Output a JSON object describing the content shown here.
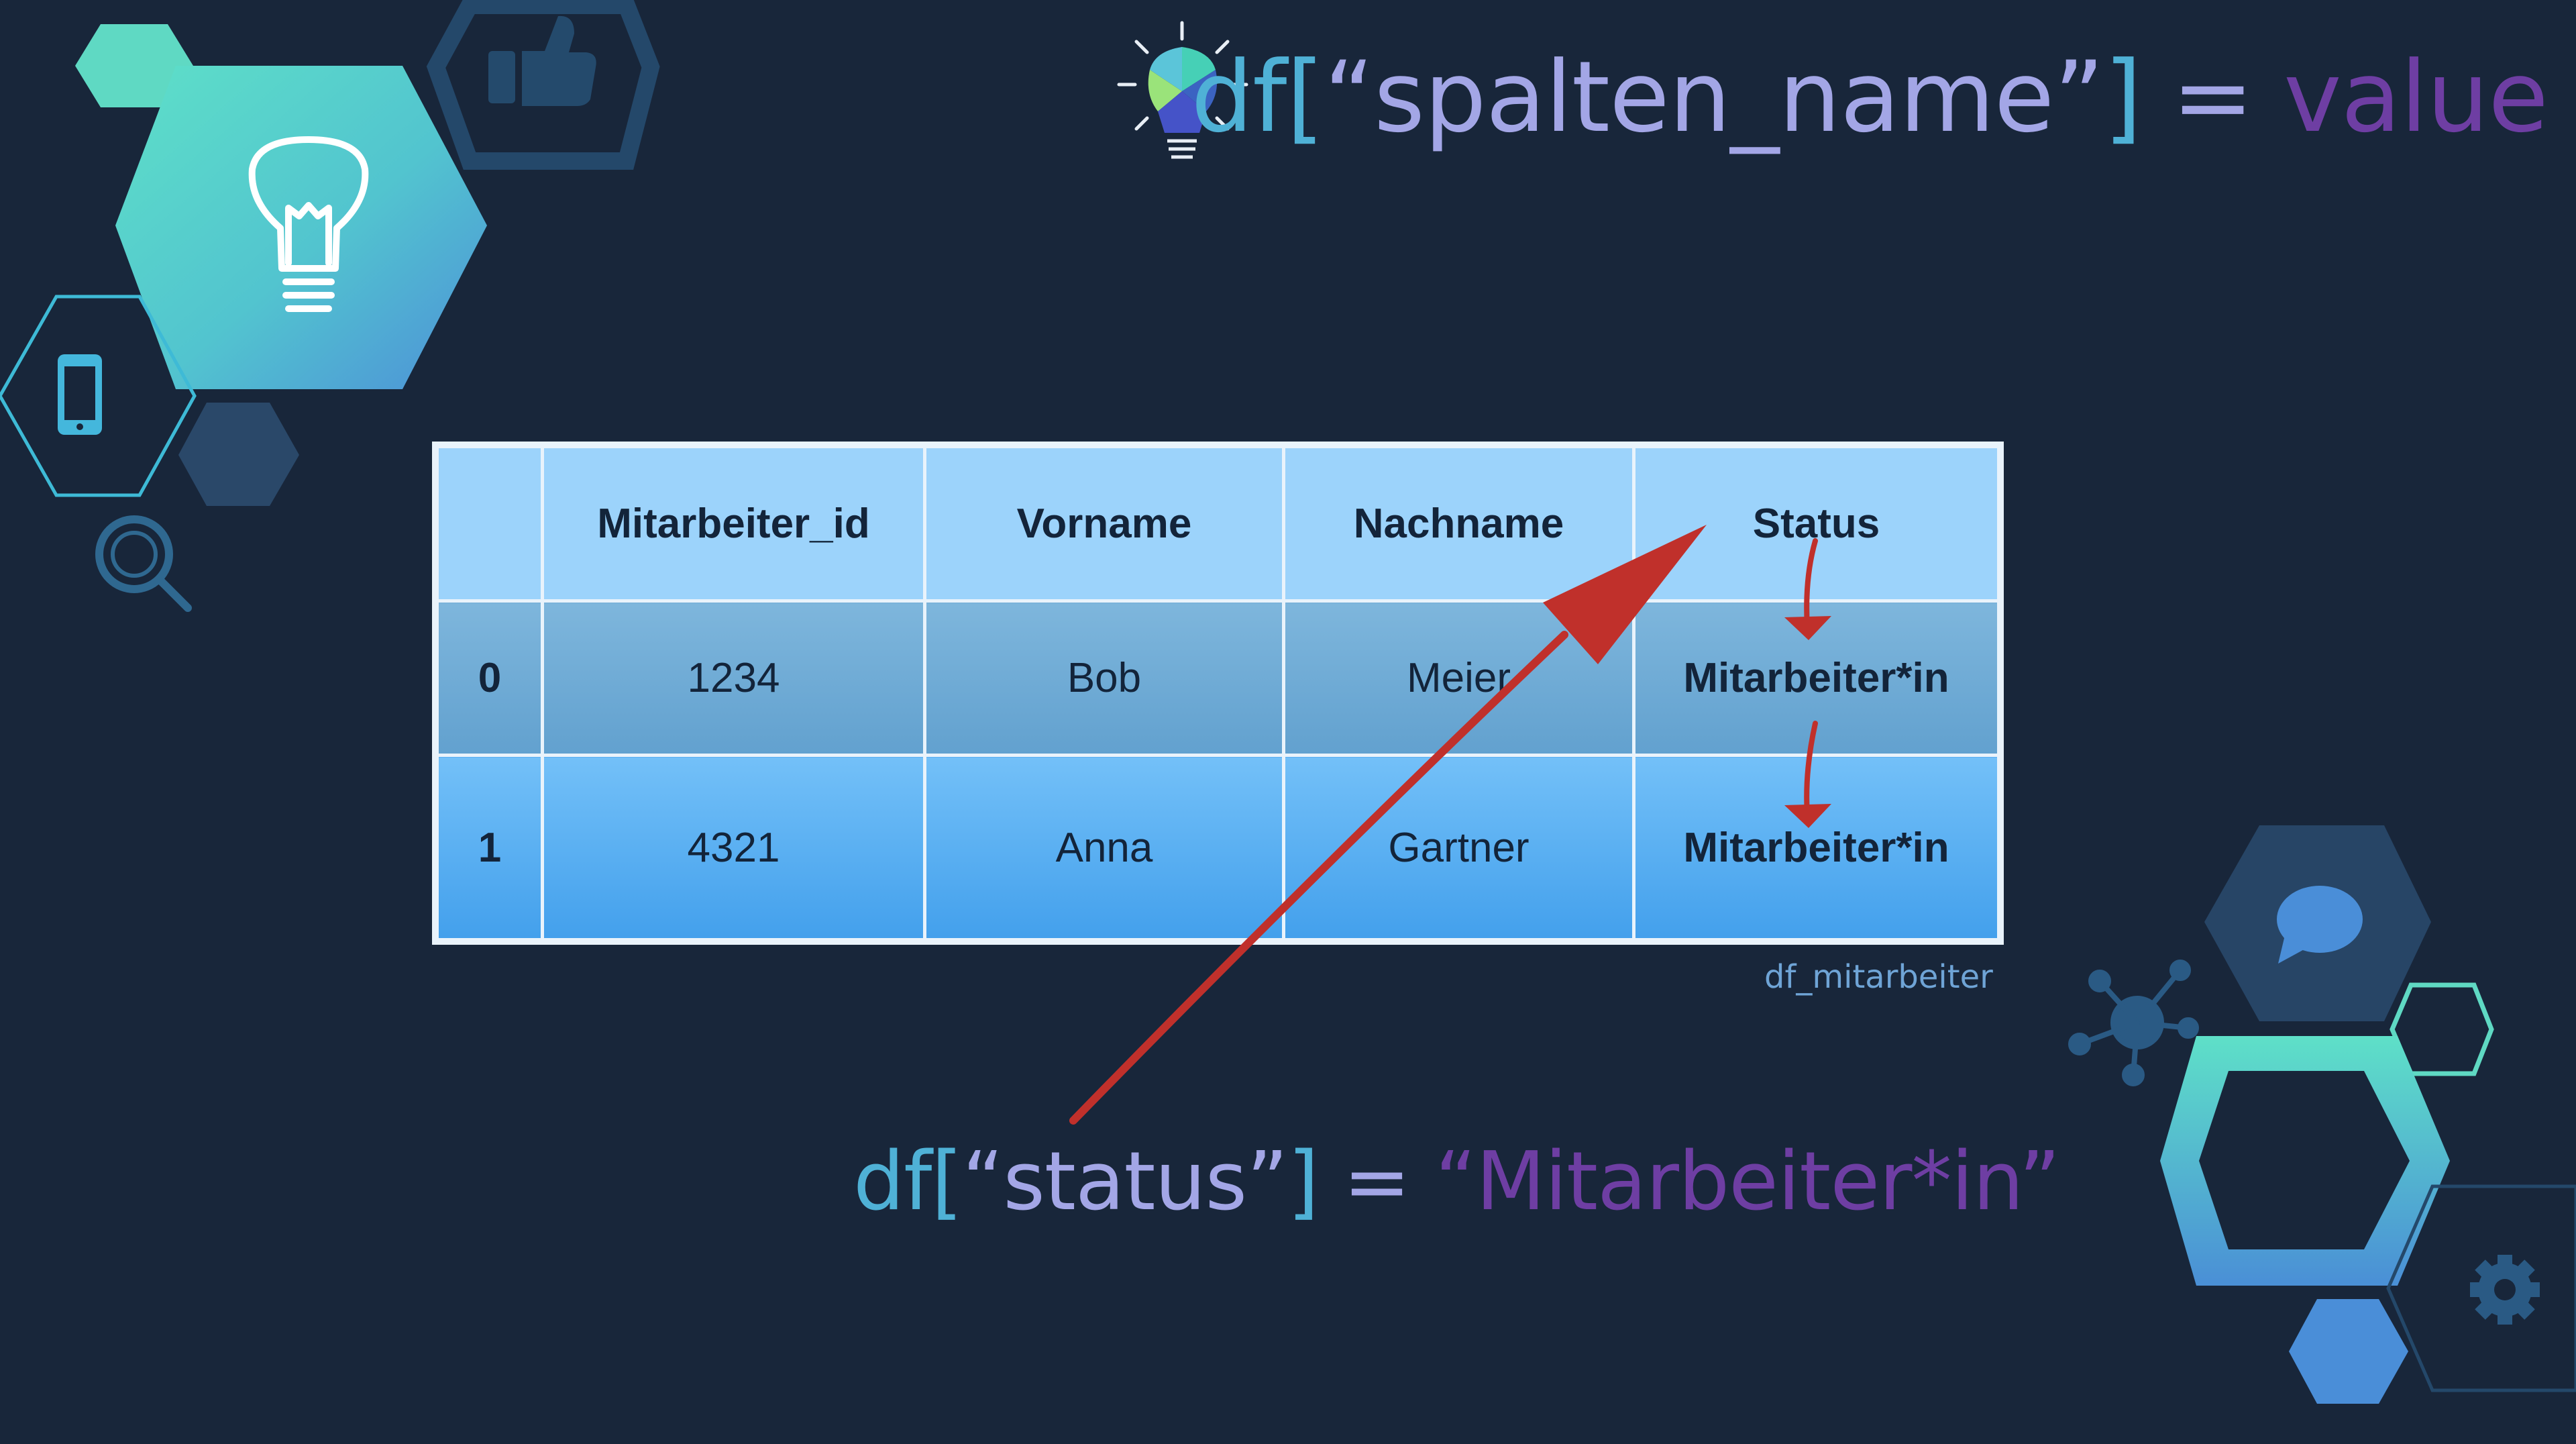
{
  "slide": {
    "formula_top": {
      "part_df": "df[",
      "part_key": "“spalten_name”",
      "part_close": "]",
      "part_eq": " = ",
      "part_value": "value"
    },
    "formula_bottom": {
      "part_df": "df[",
      "part_key": "“status”",
      "part_close": "]",
      "part_eq": " = ",
      "part_value": "“Mitarbeiter*in”"
    },
    "table_caption": "df_mitarbeiter",
    "table": {
      "headers": [
        "",
        "Mitarbeiter_id",
        "Vorname",
        "Nachname",
        "Status"
      ],
      "rows": [
        [
          "0",
          "1234",
          "Bob",
          "Meier",
          "Mitarbeiter*in"
        ],
        [
          "1",
          "4321",
          "Anna",
          "Gartner",
          "Mitarbeiter*in"
        ]
      ]
    }
  },
  "icons": [
    "lightbulb-icon",
    "thumbs-up-icon",
    "smartphone-icon",
    "magnifier-icon",
    "colored-lightbulb-icon",
    "chat-bubble-icon",
    "network-icon",
    "gear-icon"
  ],
  "colors": {
    "background": "#18263a",
    "teal": "#4fb1d6",
    "lavender": "#a3a6e6",
    "purple": "#6e3ea3",
    "arrow_red": "#c0302b",
    "table_header": "#9cd3fb",
    "table_row_0": "#6eaad6",
    "table_row_1": "#4aa6ef"
  }
}
